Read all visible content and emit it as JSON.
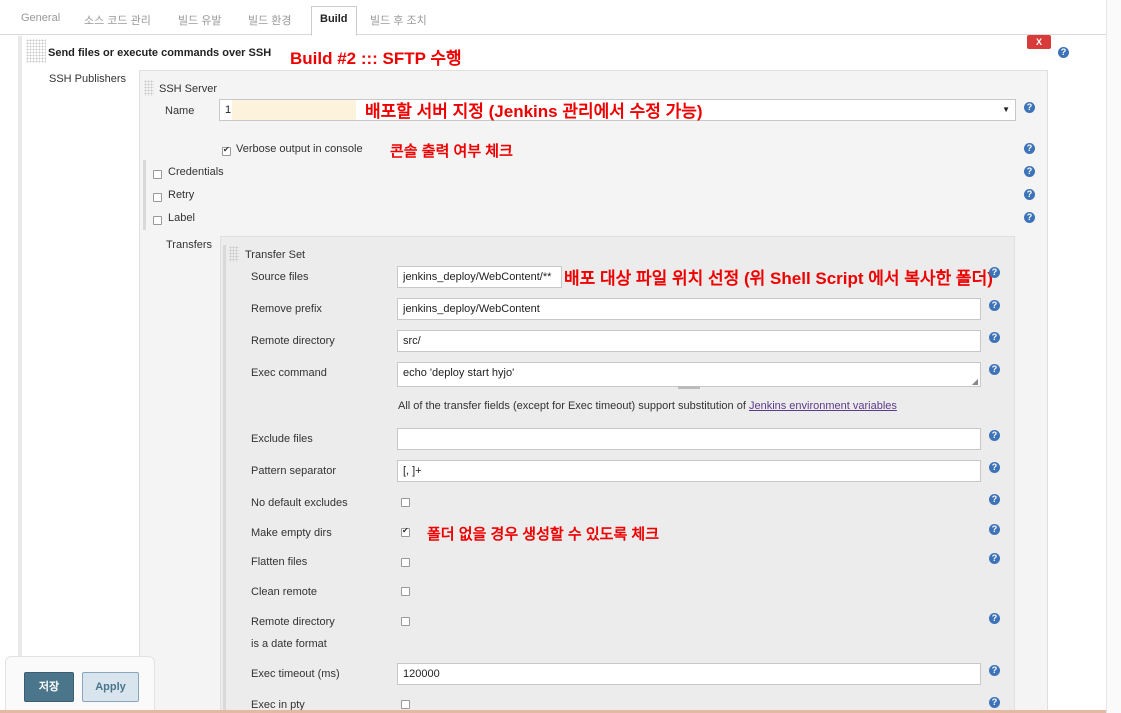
{
  "tabs": [
    {
      "label": "General"
    },
    {
      "label": "소스 코드 관리"
    },
    {
      "label": "빌드 유발"
    },
    {
      "label": "빌드 환경"
    },
    {
      "label": "Build"
    },
    {
      "label": "빌드 후 조치"
    }
  ],
  "section": {
    "title": "Send files or execute commands over SSH",
    "close_label": "X"
  },
  "ssh": {
    "publishers_label": "SSH Publishers",
    "server_header": "SSH Server",
    "name_label": "Name",
    "name_value": "1",
    "verbose_label": "Verbose output in console",
    "verbose_checked": true,
    "credentials_label": "Credentials",
    "retry_label": "Retry",
    "label_label": "Label",
    "transfers_label": "Transfers"
  },
  "transfer": {
    "header": "Transfer Set",
    "source_files_label": "Source files",
    "source_files_value": "jenkins_deploy/WebContent/**",
    "remove_prefix_label": "Remove prefix",
    "remove_prefix_value": "jenkins_deploy/WebContent",
    "remote_directory_label": "Remote directory",
    "remote_directory_value": "src/",
    "exec_command_label": "Exec command",
    "exec_command_value": "echo 'deploy start hyjo'",
    "note_prefix": "All of the transfer fields (except for Exec timeout) support substitution of ",
    "note_link": "Jenkins environment variables",
    "exclude_files_label": "Exclude files",
    "exclude_files_value": "",
    "pattern_separator_label": "Pattern separator",
    "pattern_separator_value": "[, ]+",
    "no_default_excludes_label": "No default excludes",
    "make_empty_dirs_label": "Make empty dirs",
    "make_empty_dirs_checked": true,
    "flatten_files_label": "Flatten files",
    "clean_remote_label": "Clean remote",
    "remote_date_label_1": "Remote directory",
    "remote_date_label_2": "is a date format",
    "exec_timeout_label": "Exec timeout (ms)",
    "exec_timeout_value": "120000",
    "exec_in_pty_label": "Exec in pty"
  },
  "annotations": {
    "build": "Build #2 :::  SFTP 수행",
    "server": "배포할 서버 지정 (Jenkins 관리에서 수정 가능)",
    "verbose": "콘솔 출력 여부 체크",
    "source": "배포 대상 파일 위치 선정 (위 Shell Script 에서 복사한 폴더)",
    "empty_dirs": "폴더 없을 경우 생성할 수 있도록 체크"
  },
  "buttons": {
    "save": "저장",
    "apply": "Apply"
  },
  "colors": {
    "annotation": "#ee0000",
    "help_icon": "#3d73b8",
    "save_button": "#4b758b",
    "close_button": "#d93b3b"
  }
}
